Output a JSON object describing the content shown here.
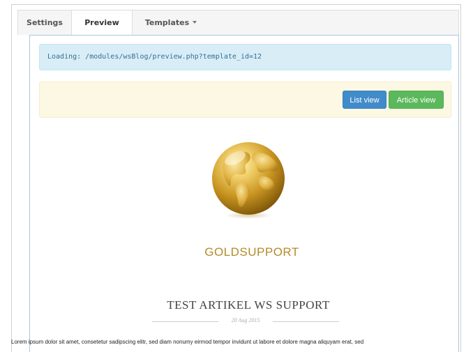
{
  "tabs": [
    {
      "label": "Settings",
      "active": false
    },
    {
      "label": "Preview",
      "active": true
    },
    {
      "label": "Templates",
      "active": false,
      "has_dropdown": true
    }
  ],
  "loading_alert": {
    "text": "Loading: /modules/wsBlog/preview.php?template_id=12"
  },
  "view_buttons": {
    "list_view": "List view",
    "article_view": "Article view"
  },
  "preview": {
    "logo_icon": "golden-globe",
    "brand_name": "GOLDSUPPORT",
    "article_title": "TEST ARTIKEL WS SUPPORT",
    "article_date": "20 Aug 2015",
    "body_text": "Lorem ipsum dolor sit amet, consetetur sadipscing elitr, sed diam nonumy eirmod tempor invidunt ut labore et dolore magna aliquyam erat, sed"
  },
  "colors": {
    "info_bg": "#d9edf7",
    "info_text": "#31708f",
    "warning_bg": "#fcf8e3",
    "primary": "#428bca",
    "success": "#5cb85c",
    "gold": "#b38b2a"
  }
}
